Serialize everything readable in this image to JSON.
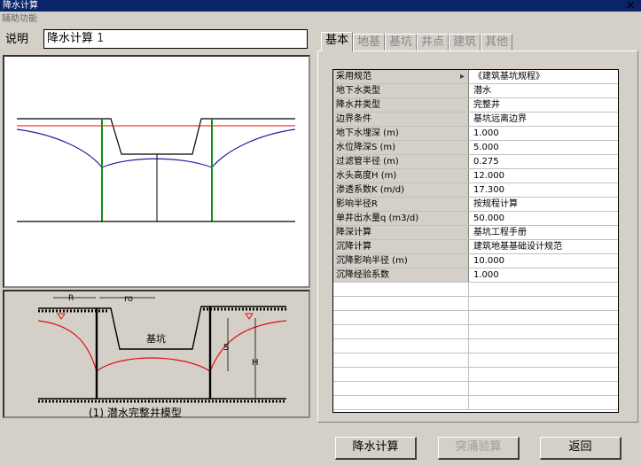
{
  "window": {
    "title": "降水计算",
    "close": "×"
  },
  "menu": {
    "item": "辅助功能"
  },
  "description": {
    "label": "说明",
    "value": "降水计算",
    "number": "1"
  },
  "diagram_bottom": {
    "label_r": "R",
    "label_ro": "ro",
    "label_pit": "基坑",
    "label_s": "S",
    "label_h": "H",
    "caption": "(1) 潜水完整井模型"
  },
  "tabs": [
    {
      "label": "基本",
      "active": true
    },
    {
      "label": "地基",
      "active": false
    },
    {
      "label": "基坑",
      "active": false
    },
    {
      "label": "井点",
      "active": false
    },
    {
      "label": "建筑",
      "active": false
    },
    {
      "label": "其他",
      "active": false
    }
  ],
  "properties": [
    {
      "key": "采用规范",
      "value": "《建筑基坑规程》",
      "dropdown": true
    },
    {
      "key": "地下水类型",
      "value": "潜水"
    },
    {
      "key": "降水井类型",
      "value": "完整井"
    },
    {
      "key": "边界条件",
      "value": "基坑远离边界"
    },
    {
      "key": "地下水埋深 (m)",
      "value": "1.000"
    },
    {
      "key": "水位降深S (m)",
      "value": "5.000"
    },
    {
      "key": "过滤管半径 (m)",
      "value": "0.275"
    },
    {
      "key": "水头高度H (m)",
      "value": "12.000"
    },
    {
      "key": "渗透系数K (m/d)",
      "value": "17.300"
    },
    {
      "key": "影响半径R",
      "value": "按规程计算"
    },
    {
      "key": "单井出水量q (m3/d)",
      "value": "50.000"
    },
    {
      "key": "降深计算",
      "value": "基坑工程手册"
    },
    {
      "key": "沉降计算",
      "value": "建筑地基基础设计规范"
    },
    {
      "key": "沉降影响半径 (m)",
      "value": "10.000"
    },
    {
      "key": "沉降经验系数",
      "value": "1.000"
    }
  ],
  "buttons": {
    "calculate": "降水计算",
    "check": "突涌验算",
    "back": "返回"
  },
  "colors": {
    "accent": "#0a246a",
    "red": "#e01010",
    "blue": "#2020a0",
    "green": "#109010"
  }
}
